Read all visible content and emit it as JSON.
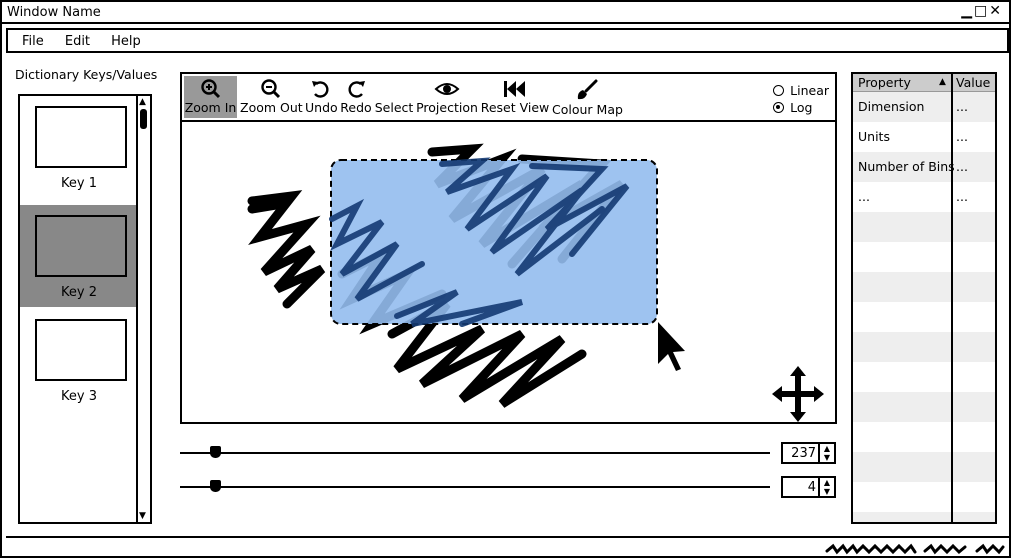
{
  "window": {
    "title": "Window Name",
    "controls": "▁□✕"
  },
  "menu": [
    "File",
    "Edit",
    "Help"
  ],
  "dictionary": {
    "label": "Dictionary Keys/Values",
    "keys": [
      {
        "label": "Key 1",
        "selected": false
      },
      {
        "label": "Key 2",
        "selected": true
      },
      {
        "label": "Key 3",
        "selected": false
      }
    ]
  },
  "toolbar": {
    "tools": [
      {
        "label": "Zoom In",
        "icon": "zoom-in-icon",
        "active": true
      },
      {
        "label": "Zoom Out",
        "icon": "zoom-out-icon",
        "active": false
      },
      {
        "label": "Undo",
        "icon": "undo-icon",
        "active": false
      },
      {
        "label": "Redo",
        "icon": "redo-icon",
        "active": false
      },
      {
        "label": "Select",
        "icon": "",
        "active": false
      },
      {
        "label": "Projection",
        "icon": "eye-icon",
        "active": false
      },
      {
        "label": "Reset View",
        "icon": "reset-view-icon",
        "active": false
      },
      {
        "label": "Colour Map",
        "icon": "brush-icon",
        "active": false
      }
    ],
    "scale": {
      "options": [
        "Linear",
        "Log"
      ],
      "selected": "Log"
    }
  },
  "sliders": [
    {
      "value": "237",
      "position": 0.06
    },
    {
      "value": "4",
      "position": 0.06
    }
  ],
  "properties": {
    "headers": {
      "property": "Property",
      "value": "Value"
    },
    "rows": [
      {
        "property": "Dimension",
        "value": "..."
      },
      {
        "property": "Units",
        "value": "..."
      },
      {
        "property": "Number of Bins",
        "value": "..."
      },
      {
        "property": "...",
        "value": "..."
      }
    ]
  },
  "colors": {
    "selection": "#94BCEE",
    "selectedKey": "#888888",
    "header": "#CCCCCC",
    "altRow": "#EEEEEE"
  }
}
